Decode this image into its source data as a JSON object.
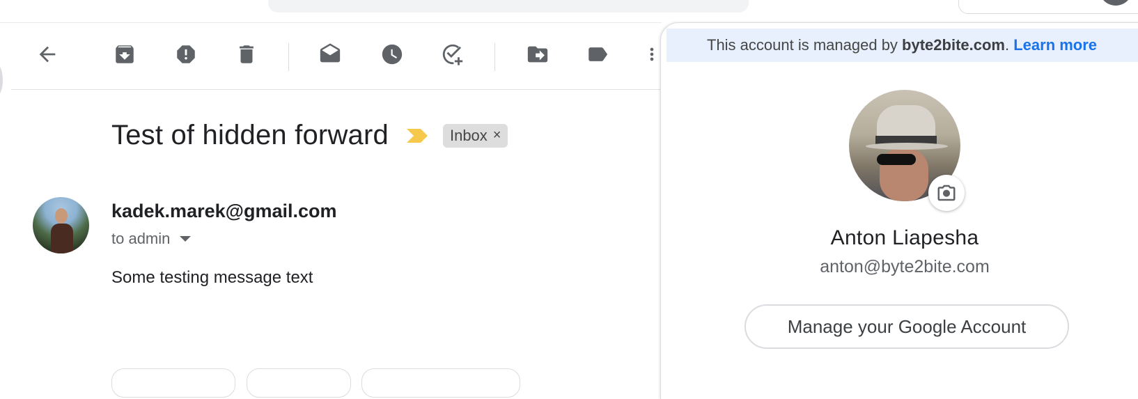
{
  "toolbar": {
    "buttons": [
      {
        "icon": "back-arrow-icon"
      },
      {
        "icon": "archive-icon"
      },
      {
        "icon": "report-spam-icon"
      },
      {
        "icon": "delete-icon"
      },
      {
        "icon": "mark-unread-icon"
      },
      {
        "icon": "snooze-icon"
      },
      {
        "icon": "add-to-tasks-icon"
      },
      {
        "icon": "move-to-icon"
      },
      {
        "icon": "label-icon"
      },
      {
        "icon": "more-vert-icon"
      }
    ]
  },
  "email": {
    "subject": "Test of hidden forward",
    "label_chip": "Inbox",
    "label_remove": "×",
    "sender": "kadek.marek@gmail.com",
    "to_line": "to admin",
    "body": "Some testing message text"
  },
  "account_popup": {
    "banner_prefix": "This account is managed by ",
    "banner_domain": "byte2bite.com",
    "banner_suffix": ". ",
    "banner_link": "Learn more",
    "name": "Anton Liapesha",
    "email": "anton@byte2bite.com",
    "manage_button": "Manage your Google Account"
  },
  "colors": {
    "link": "#1a73e8",
    "banner_bg": "#e8f0fe",
    "importance_marker": "#f6c94d",
    "icon_gray": "#5f6368"
  }
}
